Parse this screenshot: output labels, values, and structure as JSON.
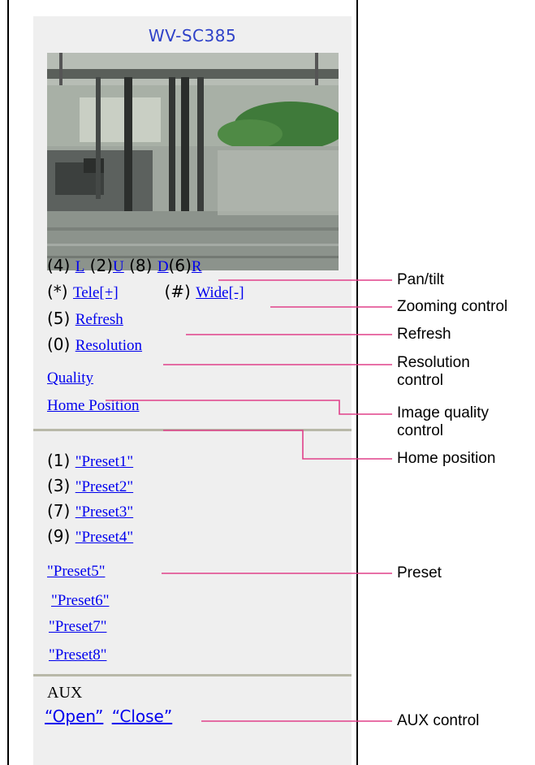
{
  "camera": {
    "title": "WV-SC385"
  },
  "controls": {
    "pan_tilt": [
      {
        "key": "(4)",
        "label": "L"
      },
      {
        "key": "(2)",
        "label": "U"
      },
      {
        "key": "(8)",
        "label": "D"
      },
      {
        "key": "(6)",
        "label": "R"
      }
    ],
    "zoom": {
      "tele_key": "(*)",
      "tele_label": "Tele[+]",
      "wide_key": "(#)",
      "wide_label": "Wide[-]"
    },
    "refresh": {
      "key": "(5)",
      "label": "Refresh"
    },
    "resolution": {
      "key": "(0)",
      "label": "Resolution"
    },
    "quality": {
      "label": "Quality"
    },
    "home": {
      "label": "Home Position"
    }
  },
  "presets": [
    {
      "key": "(1)",
      "label": "\"Preset1\""
    },
    {
      "key": "(3)",
      "label": "\"Preset2\""
    },
    {
      "key": "(7)",
      "label": "\"Preset3\""
    },
    {
      "key": "(9)",
      "label": "\"Preset4\""
    },
    {
      "key": "",
      "label": "\"Preset5\""
    },
    {
      "key": "",
      "label": "\"Preset6\""
    },
    {
      "key": "",
      "label": "\"Preset7\""
    },
    {
      "key": "",
      "label": "\"Preset8\""
    }
  ],
  "aux": {
    "heading": "AUX",
    "open_label": "“Open”",
    "close_label": "“Close”"
  },
  "callouts": {
    "pan_tilt": "Pan/tilt",
    "zoom": "Zooming control",
    "refresh": "Refresh",
    "resolution_1": "Resolution",
    "resolution_2": "control",
    "quality_1": "Image quality",
    "quality_2": "control",
    "home": "Home position",
    "preset": "Preset",
    "aux": "AUX control"
  },
  "colors": {
    "link": "#0000ee",
    "title": "#2e41c8",
    "leader_line": "#e0408a",
    "panel_bg": "#efefef"
  }
}
